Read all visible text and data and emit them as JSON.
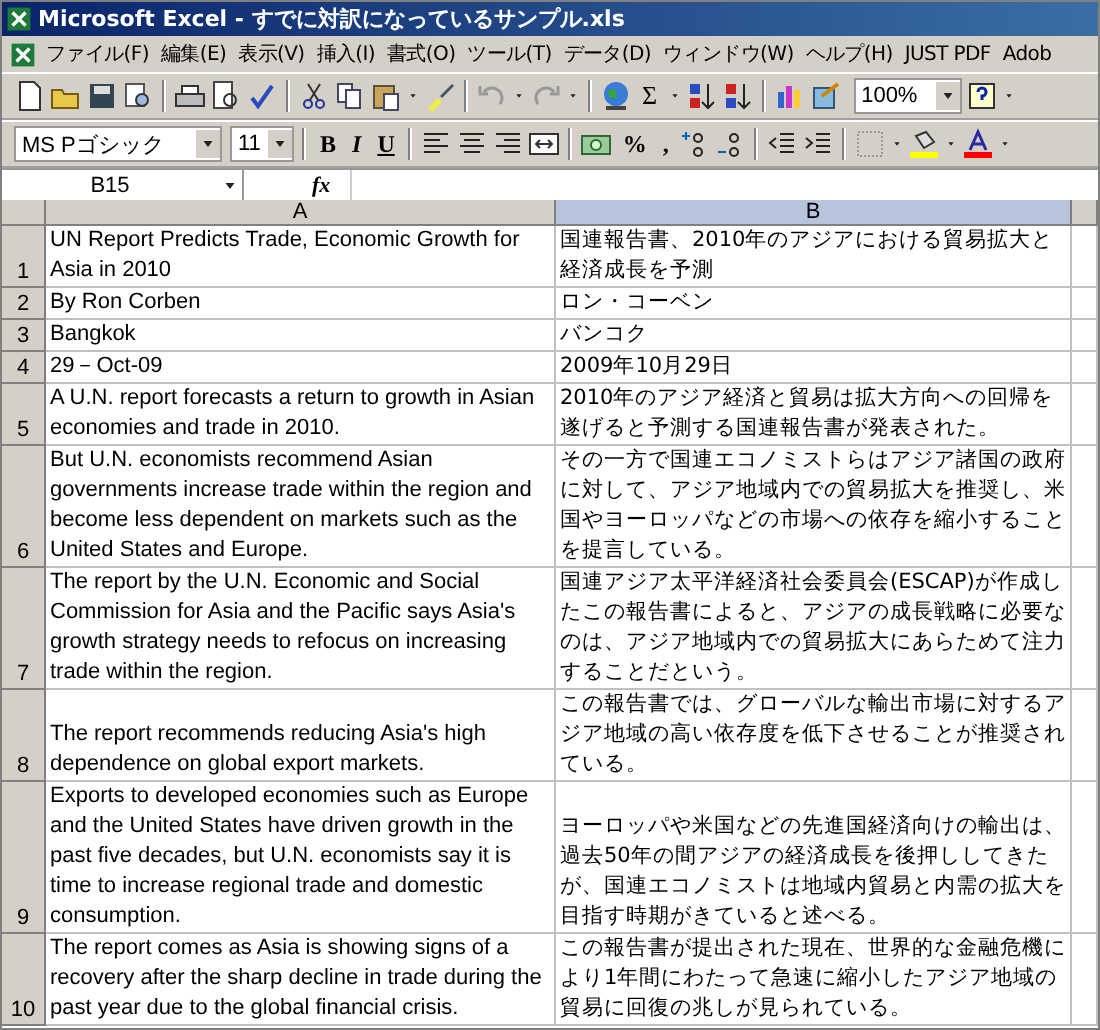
{
  "window": {
    "title": "Microsoft Excel - すでに対訳になっているサンプル.xls"
  },
  "menu": [
    "ファイル(F)",
    "編集(E)",
    "表示(V)",
    "挿入(I)",
    "書式(O)",
    "ツール(T)",
    "データ(D)",
    "ウィンドウ(W)",
    "ヘルプ(H)",
    "JUST PDF",
    "Adob"
  ],
  "standard_toolbar": {
    "sum": "Σ",
    "zoom": "100%"
  },
  "formatting_toolbar": {
    "font": "MS Pゴシック",
    "size": "11",
    "bold": "B",
    "italic": "I",
    "underline": "U",
    "percent": "%",
    "comma": ","
  },
  "formula_bar": {
    "name_box": "B15",
    "fx": "fx"
  },
  "columns": [
    {
      "label": "A",
      "selected": false
    },
    {
      "label": "B",
      "selected": true
    }
  ],
  "rows": [
    {
      "number": "1",
      "a": "UN Report Predicts Trade, Economic Growth for Asia in 2010",
      "b": "国連報告書、2010年のアジアにおける貿易拡大と経済成長を予測"
    },
    {
      "number": "2",
      "a": "By Ron Corben",
      "b": "ロン・コーベン"
    },
    {
      "number": "3",
      "a": "Bangkok",
      "b": "バンコク"
    },
    {
      "number": "4",
      "a": "29－Oct-09",
      "b": "2009年10月29日"
    },
    {
      "number": "5",
      "a": "A U.N. report forecasts a return to growth in Asian economies and trade in 2010.",
      "b": "2010年のアジア経済と貿易は拡大方向への回帰を遂げると予測する国連報告書が発表された。"
    },
    {
      "number": "6",
      "a": "But U.N. economists recommend Asian governments increase trade within the region and become less dependent on markets such as the United States and Europe.",
      "b": "その一方で国連エコノミストらはアジア諸国の政府に対して、アジア地域内での貿易拡大を推奨し、米国やヨーロッパなどの市場への依存を縮小することを提言している。"
    },
    {
      "number": "7",
      "a": "The report by the U.N. Economic and Social Commission for Asia and the Pacific says Asia's growth strategy needs to refocus on increasing trade within the region.",
      "b": "国連アジア太平洋経済社会委員会(ESCAP)が作成したこの報告書によると、アジアの成長戦略に必要なのは、アジア地域内での貿易拡大にあらためて注力することだという。"
    },
    {
      "number": "8",
      "a": "The report recommends reducing Asia's high dependence on global export markets.",
      "b": "この報告書では、グローバルな輸出市場に対するアジア地域の高い依存度を低下させることが推奨されている。"
    },
    {
      "number": "9",
      "a": "Exports to developed economies such as Europe and the United States have driven growth in the past five decades, but U.N. economists say it is time to increase regional trade and domestic consumption.",
      "b": "ヨーロッパや米国などの先進国経済向けの輸出は、過去50年の間アジアの経済成長を後押ししてきたが、国連エコノミストは地域内貿易と内需の拡大を目指す時期がきていると述べる。"
    },
    {
      "number": "10",
      "a": "The report comes as Asia is showing signs of a recovery after the sharp decline in trade during the past year due to the global financial crisis.",
      "b": "この報告書が提出された現在、世界的な金融危機により1年間にわたって急速に縮小したアジア地域の貿易に回復の兆しが見られている。"
    }
  ]
}
